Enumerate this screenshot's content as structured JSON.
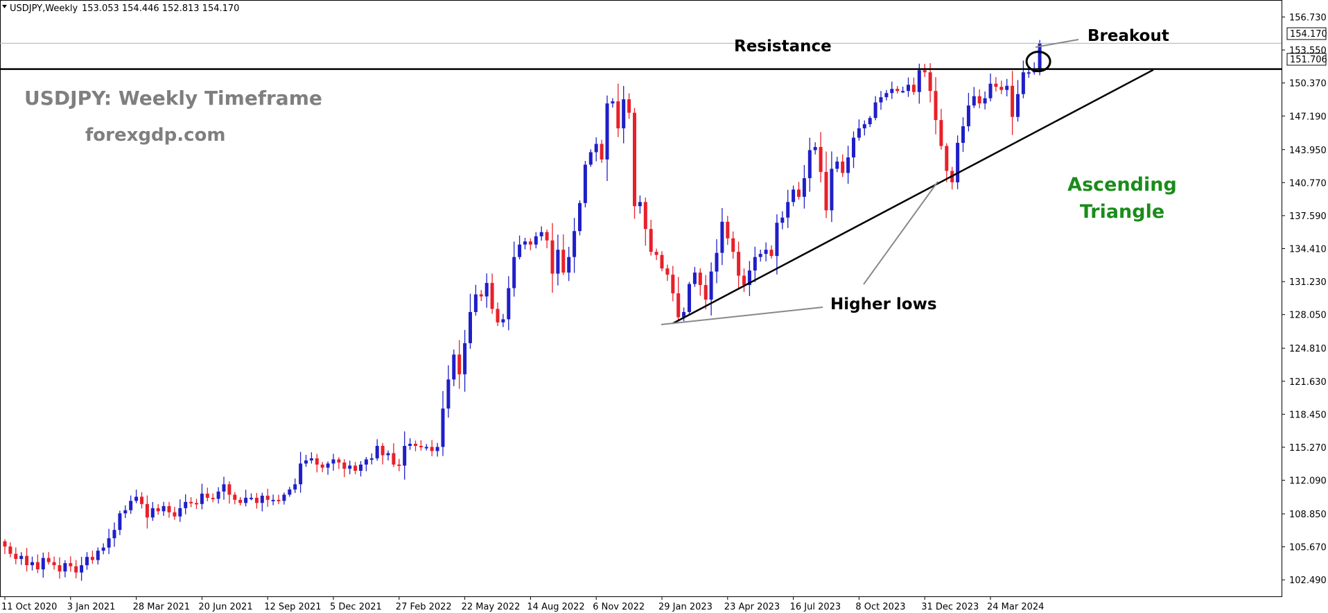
{
  "chart_data": {
    "type": "candlestick",
    "symbol_header": "USDJPY,Weekly",
    "ohlc_header": "153.053 154.446 152.813 154.170",
    "title": "USDJPY: Weekly Timeframe",
    "subtitle": "forexgdp.com",
    "ylim": [
      100.9,
      158.3
    ],
    "y_ticks": [
      "156.730",
      "153.550",
      "150.370",
      "147.190",
      "143.950",
      "140.770",
      "137.590",
      "134.410",
      "131.230",
      "128.050",
      "124.810",
      "121.630",
      "118.450",
      "115.270",
      "112.090",
      "108.850",
      "105.670",
      "102.490"
    ],
    "x_ticks": [
      "11 Oct 2020",
      "3 Jan 2021",
      "28 Mar 2021",
      "20 Jun 2021",
      "12 Sep 2021",
      "5 Dec 2021",
      "27 Feb 2022",
      "22 May 2022",
      "14 Aug 2022",
      "6 Nov 2022",
      "29 Jan 2023",
      "23 Apr 2023",
      "16 Jul 2023",
      "8 Oct 2023",
      "31 Dec 2023",
      "24 Mar 2024"
    ],
    "current_price": "154.170",
    "resistance_level": "151.706",
    "resistance_value": 151.706,
    "colors": {
      "bull": "#1f1fc8",
      "bear": "#e8202a",
      "grid_line": "#9fb3c8",
      "trend": "#000000",
      "annotation_green": "#1a8c1a",
      "title_gray": "#7f7f7f"
    },
    "closes": [
      105.7,
      105.0,
      104.5,
      104.8,
      103.9,
      104.2,
      103.5,
      104.6,
      104.2,
      103.9,
      103.3,
      104.1,
      103.8,
      103.2,
      103.9,
      104.7,
      104.4,
      105.3,
      105.6,
      106.5,
      107.3,
      108.9,
      109.2,
      110.1,
      110.5,
      109.8,
      108.5,
      109.4,
      109.1,
      109.6,
      109.0,
      108.6,
      109.4,
      110.0,
      109.9,
      109.8,
      110.8,
      110.4,
      110.3,
      111.0,
      111.7,
      110.7,
      110.2,
      109.9,
      110.4,
      110.4,
      109.9,
      110.6,
      110.2,
      110.2,
      110.1,
      110.7,
      111.2,
      111.7,
      113.7,
      114.0,
      114.2,
      113.6,
      113.3,
      113.7,
      114.1,
      113.8,
      113.2,
      113.5,
      113.0,
      113.6,
      114.1,
      114.2,
      115.4,
      114.5,
      114.7,
      113.6,
      113.5,
      115.4,
      115.6,
      115.4,
      115.3,
      115.3,
      114.9,
      115.3,
      119.0,
      121.8,
      124.2,
      122.3,
      125.3,
      128.3,
      130.0,
      129.8,
      131.1,
      128.6,
      127.3,
      127.6,
      130.6,
      133.6,
      134.8,
      135.1,
      134.8,
      135.6,
      136.0,
      135.2,
      132.0,
      134.3,
      132.1,
      133.6,
      136.1,
      138.8,
      142.5,
      143.7,
      144.5,
      143.0,
      148.4,
      148.6,
      146.0,
      148.8,
      147.5,
      138.5,
      138.9,
      136.3,
      134.1,
      133.8,
      132.5,
      131.9,
      130.1,
      127.8,
      128.3,
      131.0,
      132.1,
      130.9,
      129.5,
      132.2,
      134.0,
      137.0,
      135.4,
      134.1,
      131.8,
      130.9,
      132.3,
      133.6,
      133.9,
      134.3,
      133.7,
      136.9,
      137.4,
      138.9,
      140.1,
      139.4,
      141.2,
      143.9,
      144.2,
      141.8,
      138.1,
      142.1,
      142.8,
      141.7,
      143.2,
      145.1,
      146.0,
      146.4,
      147.0,
      148.5,
      149.0,
      149.4,
      149.8,
      149.6,
      149.6,
      150.2,
      149.5,
      151.6,
      151.4,
      149.6,
      146.8,
      144.3,
      141.9,
      140.8,
      144.6,
      146.2,
      148.2,
      149.1,
      148.4,
      148.9,
      150.3,
      150.0,
      149.7,
      150.1,
      147.1,
      149.3,
      151.4,
      151.4,
      151.7,
      154.2
    ]
  },
  "annotations": {
    "resistance": "Resistance",
    "breakout": "Breakout",
    "ascending_triangle": [
      "Ascending",
      "Triangle"
    ],
    "higher_lows": "Higher lows"
  }
}
